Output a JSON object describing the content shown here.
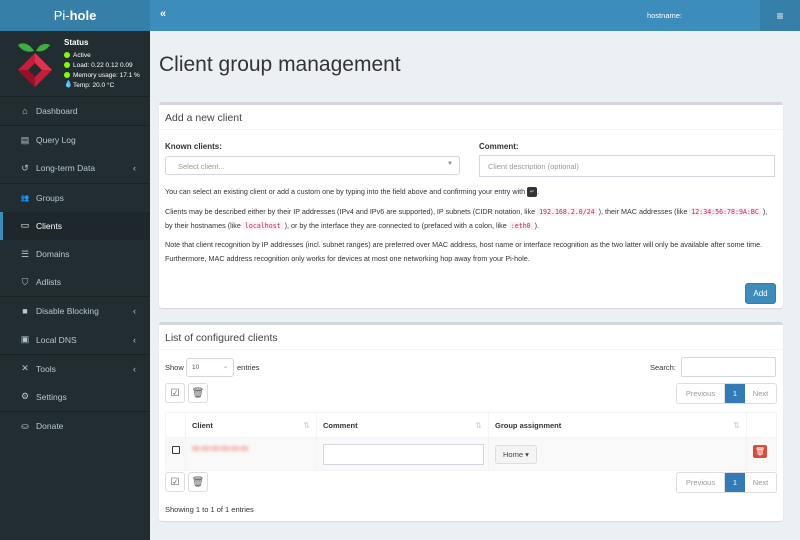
{
  "app": {
    "logo_prefix": "Pi-",
    "logo_bold": "hole"
  },
  "status": {
    "title": "Status",
    "active": "Active",
    "load": "Load:  0.22  0.12  0.09",
    "memory": "Memory usage:  17.1 %",
    "temp": "Temp: 20.0 °C",
    "indicator_color": "#7fff00"
  },
  "sidebar": {
    "items": [
      {
        "label": "Dashboard",
        "icon": "⌂"
      },
      {
        "label": "Query Log",
        "icon": "▤"
      },
      {
        "label": "Long-term Data",
        "icon": "↺",
        "chevron": "‹"
      },
      {
        "label": "Groups",
        "icon": "👥"
      },
      {
        "label": "Clients",
        "icon": "▭"
      },
      {
        "label": "Domains",
        "icon": "☰"
      },
      {
        "label": "Adlists",
        "icon": "⛉"
      },
      {
        "label": "Disable Blocking",
        "icon": "■",
        "chevron": "‹"
      },
      {
        "label": "Local DNS",
        "icon": "▣",
        "chevron": "‹"
      },
      {
        "label": "Tools",
        "icon": "✕",
        "chevron": "‹"
      },
      {
        "label": "Settings",
        "icon": "⚙"
      },
      {
        "label": "Donate",
        "icon": "⛀"
      }
    ]
  },
  "header": {
    "collapse_icon": "«",
    "hostname_label": "hostname:",
    "menu_icon": "≡"
  },
  "page": {
    "title": "Client group management"
  },
  "add_client": {
    "title": "Add a new client",
    "known_clients_label": "Known clients:",
    "select_placeholder": "Select client...",
    "comment_label": "Comment:",
    "comment_placeholder": "Client description (optional)",
    "help1_text": "You can select an existing client or add a custom one by typing into the field above and confirming your entry with ",
    "help1_key": "↵",
    "help2_a": "Clients may be described either by their IP addresses (IPv4 and IPv6 are supported), IP subnets (CIDR notation, like ",
    "help2_code1": "192.168.2.0/24",
    "help2_b": " ), their MAC addresses (like ",
    "help2_code2": "12:34:56:78:9A:BC",
    "help2_c": " ), by their hostnames (like ",
    "help2_code3": "localhost",
    "help2_d": " ), or by the interface they are connected to (prefaced with a colon, like ",
    "help2_code4": ":eth0",
    "help2_e": " ).",
    "help3": "Note that client recognition by IP addresses (incl. subnet ranges) are preferred over MAC address, host name or interface recognition as the two latter will only be available after some time. Furthermore, MAC address recognition only works for devices at most one networking hop away from your Pi-hole.",
    "add_button": "Add"
  },
  "client_list": {
    "title": "List of configured clients",
    "show_label": "Show",
    "entries_label": "entries",
    "page_length": "10",
    "search_label": "Search:",
    "search_value": "",
    "pagination": {
      "previous": "Previous",
      "current": "1",
      "next": "Next"
    },
    "columns": [
      "Client",
      "Comment",
      "Group assignment"
    ],
    "sort_icon": "⇅",
    "rows": [
      {
        "client": "00:00:00:00:00:00",
        "comment": "",
        "group": "Home ▾"
      }
    ],
    "info": "Showing 1 to 1 of 1 entries"
  }
}
